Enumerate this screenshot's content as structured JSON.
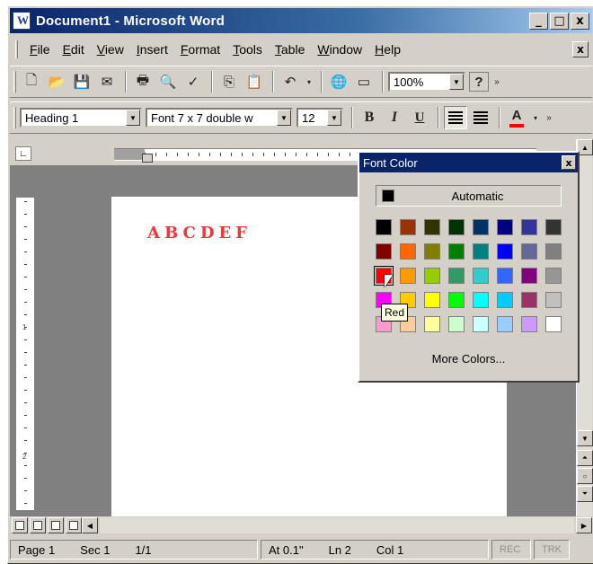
{
  "window": {
    "title": "Document1 - Microsoft Word",
    "minimize": "_",
    "maximize": "□",
    "close": "x"
  },
  "menubar": {
    "items": [
      "File",
      "Edit",
      "View",
      "Insert",
      "Format",
      "Tools",
      "Table",
      "Window",
      "Help"
    ],
    "close": "x"
  },
  "standard_toolbar": {
    "zoom": "100%",
    "help_icon": "?"
  },
  "formatting_toolbar": {
    "style": "Heading 1",
    "font": "Font 7 x 7 double w",
    "size": "12",
    "bold": "B",
    "italic": "I",
    "underline": "U",
    "font_color_glyph": "A",
    "font_color_value": "#ff0000"
  },
  "document": {
    "text": "ABCDEF",
    "text_color": "#ff3333"
  },
  "vertical_ruler": {
    "labels": [
      "1",
      "2"
    ]
  },
  "status_bar": {
    "page": "Page 1",
    "section": "Sec 1",
    "page_of": "1/1",
    "at": "At 0.1\"",
    "line": "Ln 2",
    "col": "Col 1",
    "rec": "REC",
    "trk": "TRK"
  },
  "font_color_popup": {
    "title": "Font Color",
    "automatic_label": "Automatic",
    "more_colors_label": "More Colors...",
    "tooltip": "Red",
    "selected_index": 16,
    "swatches": [
      "#000000",
      "#993300",
      "#333300",
      "#003300",
      "#003366",
      "#000080",
      "#333399",
      "#333333",
      "#800000",
      "#ff6600",
      "#808000",
      "#008000",
      "#008080",
      "#0000ff",
      "#666699",
      "#808080",
      "#ff0000",
      "#ff9900",
      "#99cc00",
      "#339966",
      "#33cccc",
      "#3366ff",
      "#800080",
      "#969696",
      "#ff00ff",
      "#ffcc00",
      "#ffff00",
      "#00ff00",
      "#00ffff",
      "#00ccff",
      "#993366",
      "#c0c0c0",
      "#ff99cc",
      "#ffcc99",
      "#ffff99",
      "#ccffcc",
      "#ccffff",
      "#99ccff",
      "#cc99ff",
      "#ffffff"
    ]
  }
}
